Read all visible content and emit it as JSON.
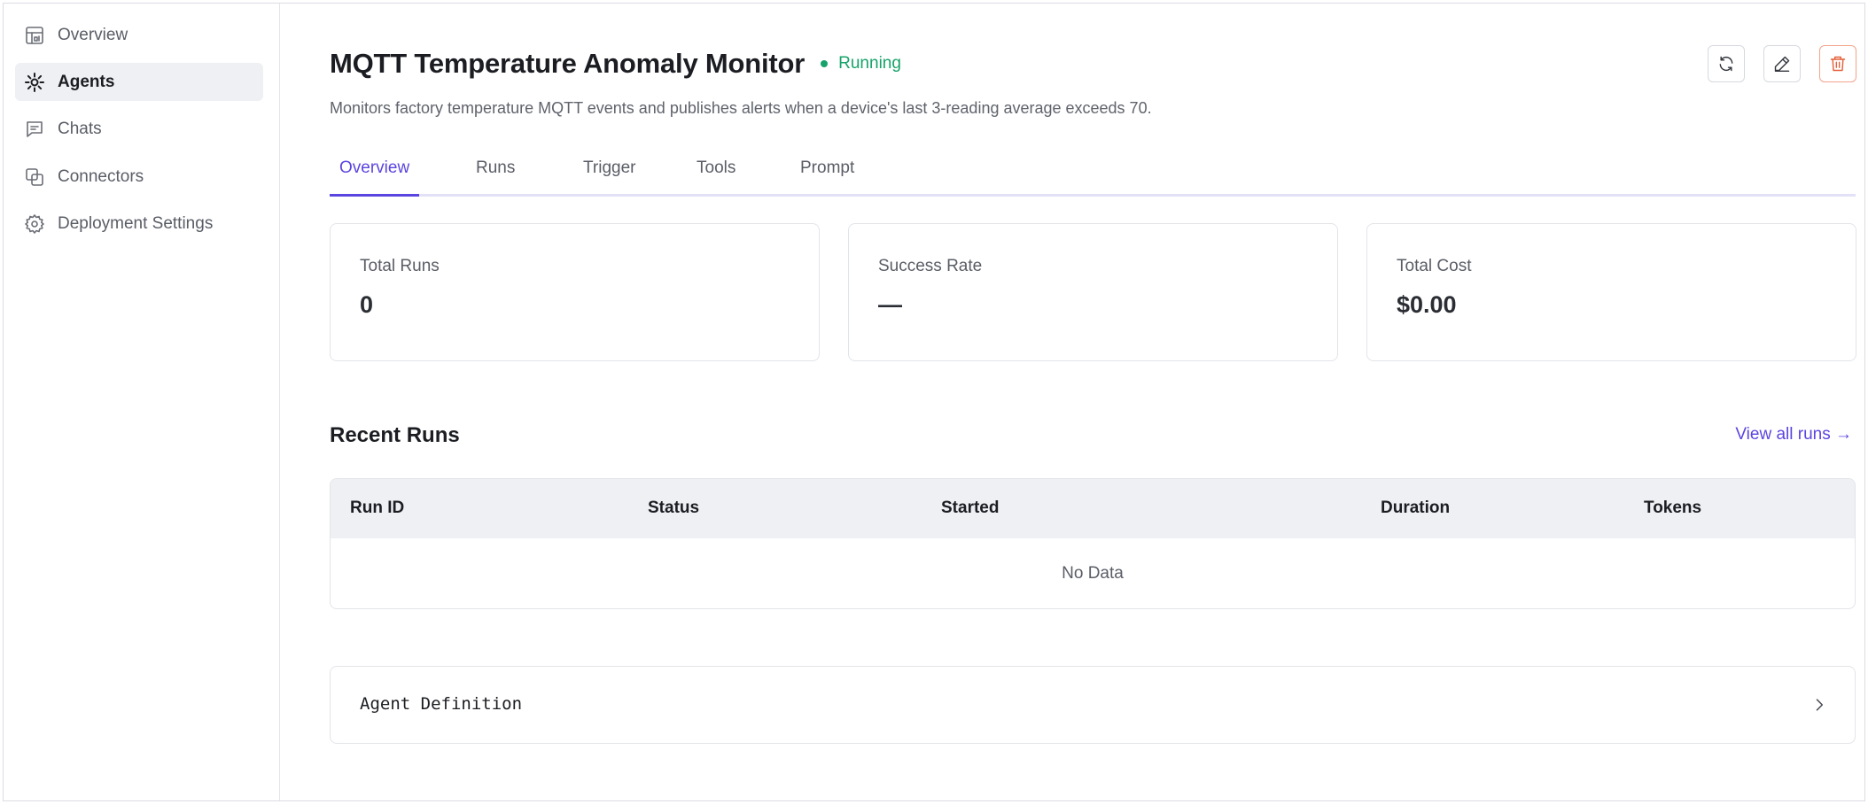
{
  "sidebar": {
    "items": [
      {
        "label": "Overview",
        "icon": "dashboard-icon",
        "active": false
      },
      {
        "label": "Agents",
        "icon": "sparkle-icon",
        "active": true
      },
      {
        "label": "Chats",
        "icon": "chat-icon",
        "active": false
      },
      {
        "label": "Connectors",
        "icon": "link-squares-icon",
        "active": false
      },
      {
        "label": "Deployment Settings",
        "icon": "gear-icon",
        "active": false
      }
    ]
  },
  "header": {
    "title": "MQTT Temperature Anomaly Monitor",
    "status": "Running",
    "description": "Monitors factory temperature MQTT events and publishes alerts when a device's last 3-reading average exceeds 70.",
    "actions": [
      {
        "name": "refresh",
        "icon": "refresh-icon"
      },
      {
        "name": "edit",
        "icon": "pencil-icon"
      },
      {
        "name": "delete",
        "icon": "trash-icon"
      }
    ]
  },
  "tabs": [
    {
      "label": "Overview",
      "active": true
    },
    {
      "label": "Runs",
      "active": false
    },
    {
      "label": "Trigger",
      "active": false
    },
    {
      "label": "Tools",
      "active": false
    },
    {
      "label": "Prompt",
      "active": false
    }
  ],
  "stats": [
    {
      "label": "Total Runs",
      "value": "0"
    },
    {
      "label": "Success Rate",
      "value": "—"
    },
    {
      "label": "Total Cost",
      "value": "$0.00"
    }
  ],
  "recent_runs": {
    "title": "Recent Runs",
    "view_all": "View all runs →",
    "columns": [
      "Run ID",
      "Status",
      "Started",
      "Duration",
      "Tokens"
    ],
    "empty_text": "No Data"
  },
  "definition": {
    "label": "Agent Definition"
  },
  "colors": {
    "accent": "#5b45e0",
    "running": "#16a36a",
    "danger": "#e5603a"
  }
}
